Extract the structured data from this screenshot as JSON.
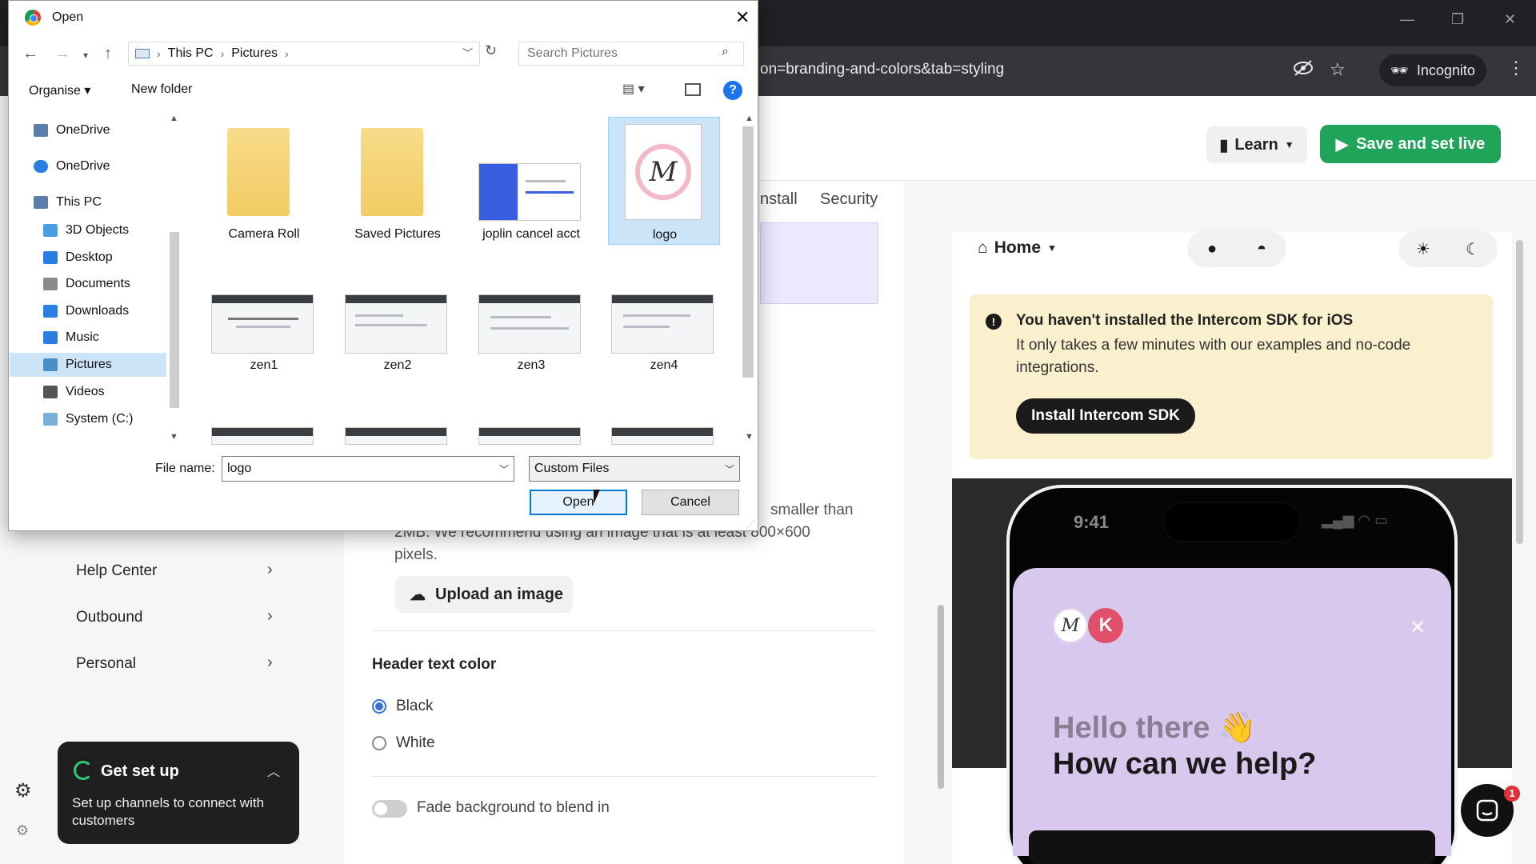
{
  "browser": {
    "url_fragment": "on=branding-and-colors&tab=styling",
    "incognito_label": "Incognito",
    "menu_glyph": "⋮",
    "window_controls": [
      "—",
      "❐",
      "✕"
    ]
  },
  "app": {
    "header": {
      "learn_label": "Learn",
      "save_label": "Save and set live"
    },
    "tabs": [
      "nstall",
      "Security"
    ],
    "nav": [
      {
        "label": "Help Center"
      },
      {
        "label": "Outbound"
      },
      {
        "label": "Personal"
      }
    ],
    "setup_card": {
      "title": "Get set up",
      "description": "Set up channels to connect with customers"
    },
    "settings": {
      "size_hint_line1": "smaller than",
      "size_hint_line2": "2MB. We recommend using an image that is at least 800×600",
      "size_hint_line3": "pixels.",
      "upload_label": "Upload an image",
      "header_text_color_label": "Header text color",
      "color_options": [
        {
          "label": "Black",
          "checked": true
        },
        {
          "label": "White",
          "checked": false
        }
      ],
      "fade_label": "Fade background to blend in"
    },
    "preview": {
      "home_label": "Home",
      "sdk_banner": {
        "title": "You haven't installed the Intercom SDK for iOS",
        "description": "It only takes a few minutes with our examples and no-code integrations.",
        "button_label": "Install Intercom SDK"
      },
      "phone_time": "9:41",
      "avatar_logo_letter": "M",
      "avatar_letter": "K",
      "greeting": "Hello there 👋",
      "help_prompt": "How can we help?",
      "launcher_badge": "1"
    },
    "colors": {
      "brand_green": "#1fa45a",
      "banner_yellow": "#faf0cd",
      "messenger_purple": "#d9c8ee"
    }
  },
  "dialog": {
    "title": "Open",
    "breadcrumb": [
      "This PC",
      "Pictures"
    ],
    "search_placeholder": "Search Pictures",
    "organise_label": "Organise ▾",
    "new_folder_label": "New folder",
    "help_glyph": "?",
    "tree": [
      {
        "label": "OneDrive",
        "icon": "onedrive-business-icon",
        "color": "#5a7ea8"
      },
      {
        "label": "OneDrive",
        "icon": "onedrive-cloud-icon",
        "color": "#2a7de1"
      },
      {
        "label": "This PC",
        "icon": "pc-icon",
        "color": "#5a7ea8"
      },
      {
        "label": "3D Objects",
        "icon": "cube-icon",
        "color": "#48a0e0"
      },
      {
        "label": "Desktop",
        "icon": "desktop-icon",
        "color": "#2a7de1"
      },
      {
        "label": "Documents",
        "icon": "documents-icon",
        "color": "#8a8a8a"
      },
      {
        "label": "Downloads",
        "icon": "download-arrow-icon",
        "color": "#2a7de1"
      },
      {
        "label": "Music",
        "icon": "music-note-icon",
        "color": "#2a7de1"
      },
      {
        "label": "Pictures",
        "icon": "pictures-icon",
        "color": "#4a90c8",
        "selected": true
      },
      {
        "label": "Videos",
        "icon": "film-icon",
        "color": "#555"
      },
      {
        "label": "System (C:)",
        "icon": "drive-icon",
        "color": "#7ab0d8"
      }
    ],
    "files": [
      {
        "name": "Camera Roll",
        "kind": "folder"
      },
      {
        "name": "Saved Pictures",
        "kind": "folder"
      },
      {
        "name": "joplin cancel acct",
        "kind": "image"
      },
      {
        "name": "logo",
        "kind": "logo",
        "selected": true
      },
      {
        "name": "zen1",
        "kind": "image"
      },
      {
        "name": "zen2",
        "kind": "image"
      },
      {
        "name": "zen3",
        "kind": "image"
      },
      {
        "name": "zen4",
        "kind": "image"
      }
    ],
    "logo_letter": "M",
    "filename_label": "File name:",
    "filename_value": "logo",
    "filetype_value": "Custom Files",
    "open_label": "Open",
    "cancel_label": "Cancel"
  }
}
